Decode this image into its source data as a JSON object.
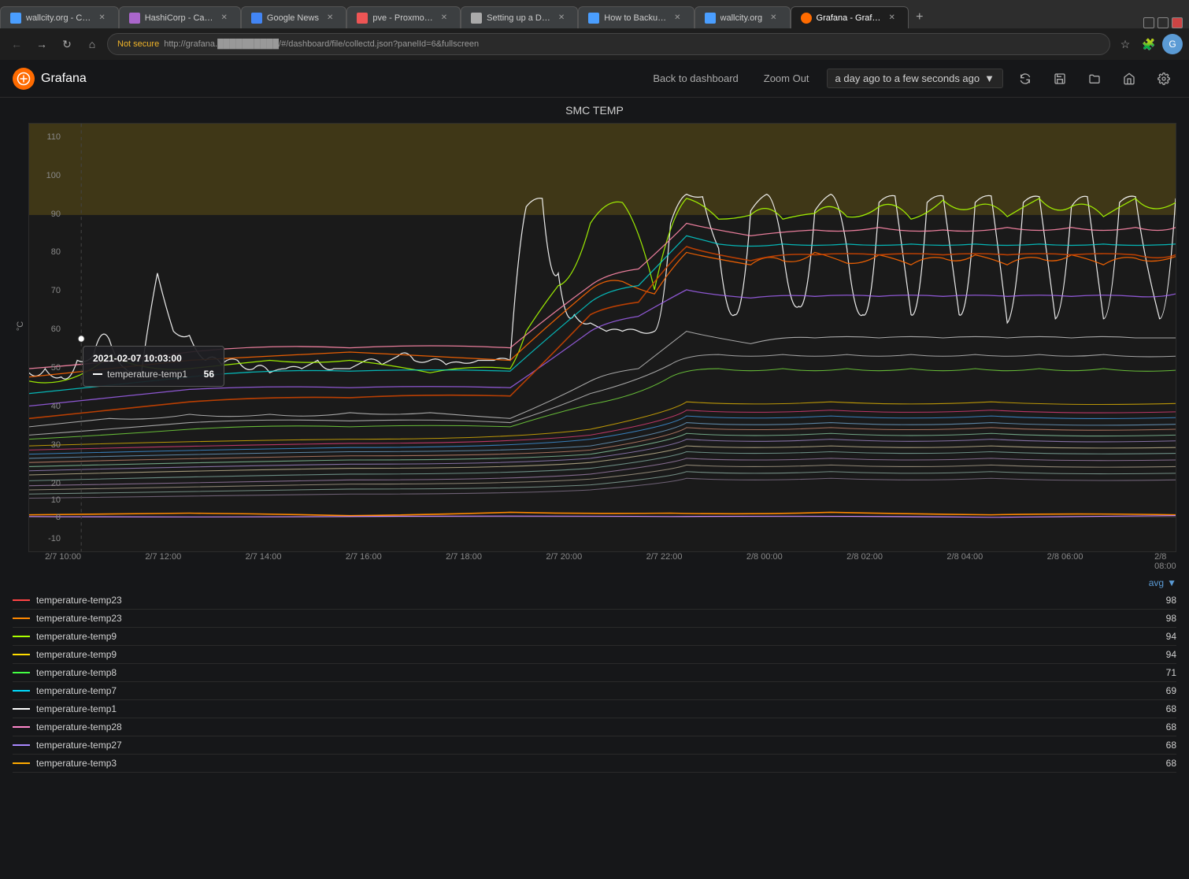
{
  "browser": {
    "tabs": [
      {
        "id": "t1",
        "label": "wallcity.org - C…",
        "favicon_color": "#4a9eff",
        "active": false
      },
      {
        "id": "t2",
        "label": "HashiCorp - Ca…",
        "favicon_color": "#aa66cc",
        "active": false
      },
      {
        "id": "t3",
        "label": "Google News",
        "favicon_color": "#4285f4",
        "active": false
      },
      {
        "id": "t4",
        "label": "pve - Proxmo…",
        "favicon_color": "#e55",
        "active": false
      },
      {
        "id": "t5",
        "label": "Setting up a D…",
        "favicon_color": "#aaa",
        "active": false
      },
      {
        "id": "t6",
        "label": "How to Backu…",
        "favicon_color": "#4a9eff",
        "active": false
      },
      {
        "id": "t7",
        "label": "wallcity.org",
        "favicon_color": "#4a9eff",
        "active": false
      },
      {
        "id": "t8",
        "label": "Grafana - Graf…",
        "favicon_color": "#ff6b00",
        "active": true
      }
    ],
    "address": "http://grafana.██████████/#/dashboard/file/collectd.json?panelId=6&fullscreen",
    "secure_label": "Not secure"
  },
  "grafana": {
    "title": "Grafana",
    "header_buttons": {
      "back": "Back to dashboard",
      "zoom_out": "Zoom Out",
      "time_range": "a day ago to a few seconds ago"
    },
    "panel": {
      "title": "SMC TEMP",
      "y_axis_label": "°C",
      "y_ticks": [
        "110",
        "100",
        "90",
        "80",
        "70",
        "60",
        "50",
        "40",
        "30",
        "20",
        "10",
        "0",
        "-10"
      ],
      "x_ticks": [
        "2/7 10:00",
        "2/7 12:00",
        "2/7 14:00",
        "2/7 16:00",
        "2/7 18:00",
        "2/7 20:00",
        "2/7 22:00",
        "2/8 00:00",
        "2/8 02:00",
        "2/8 04:00",
        "2/8 06:00",
        "2/8 08:00"
      ],
      "tooltip": {
        "time": "2021-02-07 10:03:00",
        "series_label": "temperature-temp1",
        "series_value": "56"
      }
    },
    "legend": {
      "sort_label": "avg",
      "items": [
        {
          "name": "temperature-temp23",
          "color": "#ff4444",
          "value": "98"
        },
        {
          "name": "temperature-temp23",
          "color": "#ff8800",
          "value": "98"
        },
        {
          "name": "temperature-temp9",
          "color": "#aaff00",
          "value": "94"
        },
        {
          "name": "temperature-temp9",
          "color": "#ffdd00",
          "value": "94"
        },
        {
          "name": "temperature-temp8",
          "color": "#44ff44",
          "value": "71"
        },
        {
          "name": "temperature-temp7",
          "color": "#00ddff",
          "value": "69"
        },
        {
          "name": "temperature-temp1",
          "color": "#ffffff",
          "value": "68"
        },
        {
          "name": "temperature-temp28",
          "color": "#ff88cc",
          "value": "68"
        },
        {
          "name": "temperature-temp27",
          "color": "#aa88ff",
          "value": "68"
        },
        {
          "name": "temperature-temp3",
          "color": "#ffaa00",
          "value": "68"
        }
      ]
    }
  }
}
